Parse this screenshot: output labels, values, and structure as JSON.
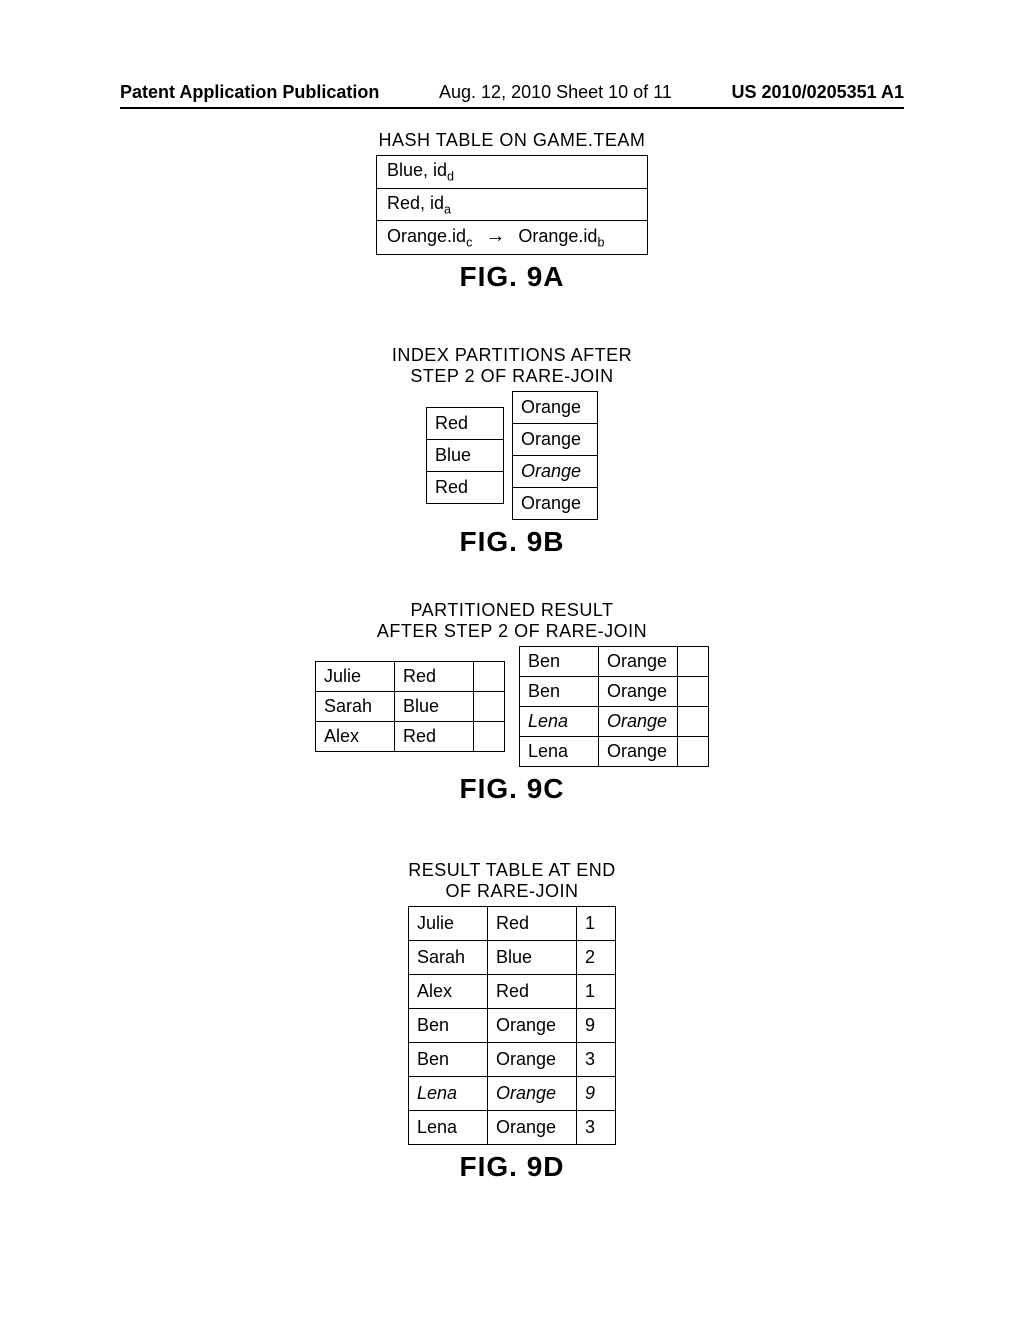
{
  "header": {
    "left": "Patent Application Publication",
    "mid": "Aug. 12, 2010  Sheet 10 of 11",
    "right": "US 2010/0205351 A1"
  },
  "fig9a": {
    "caption": "HASH TABLE ON GAME.TEAM",
    "rows": [
      {
        "pre1": "Blue, id",
        "sub1": "d",
        "arrow": "",
        "pre2": "",
        "sub2": ""
      },
      {
        "pre1": "Red, id",
        "sub1": "a",
        "arrow": "",
        "pre2": "",
        "sub2": ""
      },
      {
        "pre1": "Orange.id",
        "sub1": "c",
        "arrow": "→",
        "pre2": "Orange.id",
        "sub2": "b"
      }
    ],
    "label": "FIG. 9A"
  },
  "fig9b": {
    "caption_l1": "INDEX PARTITIONS AFTER",
    "caption_l2": "STEP 2 OF RARE-JOIN",
    "left": [
      "Red",
      "Blue",
      "Red"
    ],
    "right": [
      {
        "v": "Orange",
        "italic": false
      },
      {
        "v": "Orange",
        "italic": false
      },
      {
        "v": "Orange",
        "italic": true
      },
      {
        "v": "Orange",
        "italic": false
      }
    ],
    "label": "FIG. 9B"
  },
  "fig9c": {
    "caption_l1": "PARTITIONED RESULT",
    "caption_l2": "AFTER STEP 2 OF RARE-JOIN",
    "left": [
      {
        "a": "Julie",
        "b": "Red"
      },
      {
        "a": "Sarah",
        "b": "Blue"
      },
      {
        "a": "Alex",
        "b": "Red"
      }
    ],
    "right": [
      {
        "a": "Ben",
        "b": "Orange",
        "italic": false
      },
      {
        "a": "Ben",
        "b": "Orange",
        "italic": false
      },
      {
        "a": "Lena",
        "b": "Orange",
        "italic": true
      },
      {
        "a": "Lena",
        "b": "Orange",
        "italic": false
      }
    ],
    "label": "FIG. 9C"
  },
  "fig9d": {
    "caption_l1": "RESULT TABLE AT END",
    "caption_l2": "OF RARE-JOIN",
    "rows": [
      {
        "a": "Julie",
        "b": "Red",
        "c": "1",
        "italic": false
      },
      {
        "a": "Sarah",
        "b": "Blue",
        "c": "2",
        "italic": false
      },
      {
        "a": "Alex",
        "b": "Red",
        "c": "1",
        "italic": false
      },
      {
        "a": "Ben",
        "b": "Orange",
        "c": "9",
        "italic": false
      },
      {
        "a": "Ben",
        "b": "Orange",
        "c": "3",
        "italic": false
      },
      {
        "a": "Lena",
        "b": "Orange",
        "c": "9",
        "italic": true
      },
      {
        "a": "Lena",
        "b": "Orange",
        "c": "3",
        "italic": false
      }
    ],
    "label": "FIG. 9D"
  }
}
